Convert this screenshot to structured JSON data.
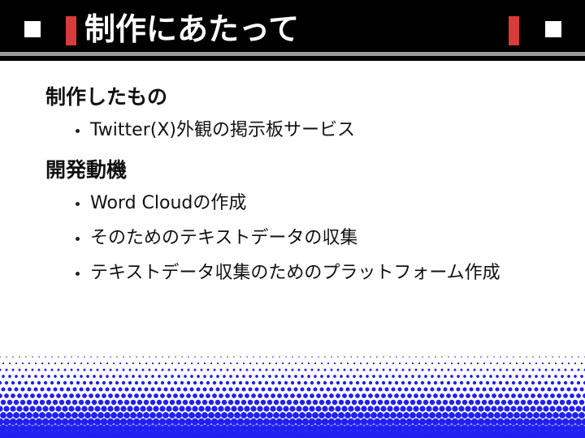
{
  "slide": {
    "title": "制作にあたって",
    "sections": [
      {
        "heading": "制作したもの",
        "bullets": [
          "Twitter(X)外観の掲示板サービス"
        ]
      },
      {
        "heading": "開発動機",
        "bullets": [
          "Word Cloudの作成",
          "そのためのテキストデータの収集",
          "テキストデータ収集のためのプラットフォーム作成"
        ]
      }
    ]
  },
  "colors": {
    "title_bar": "#000000",
    "title_text": "#ffffff",
    "accent_red": "#d93a3a",
    "pattern_blue": "#2020f0"
  }
}
